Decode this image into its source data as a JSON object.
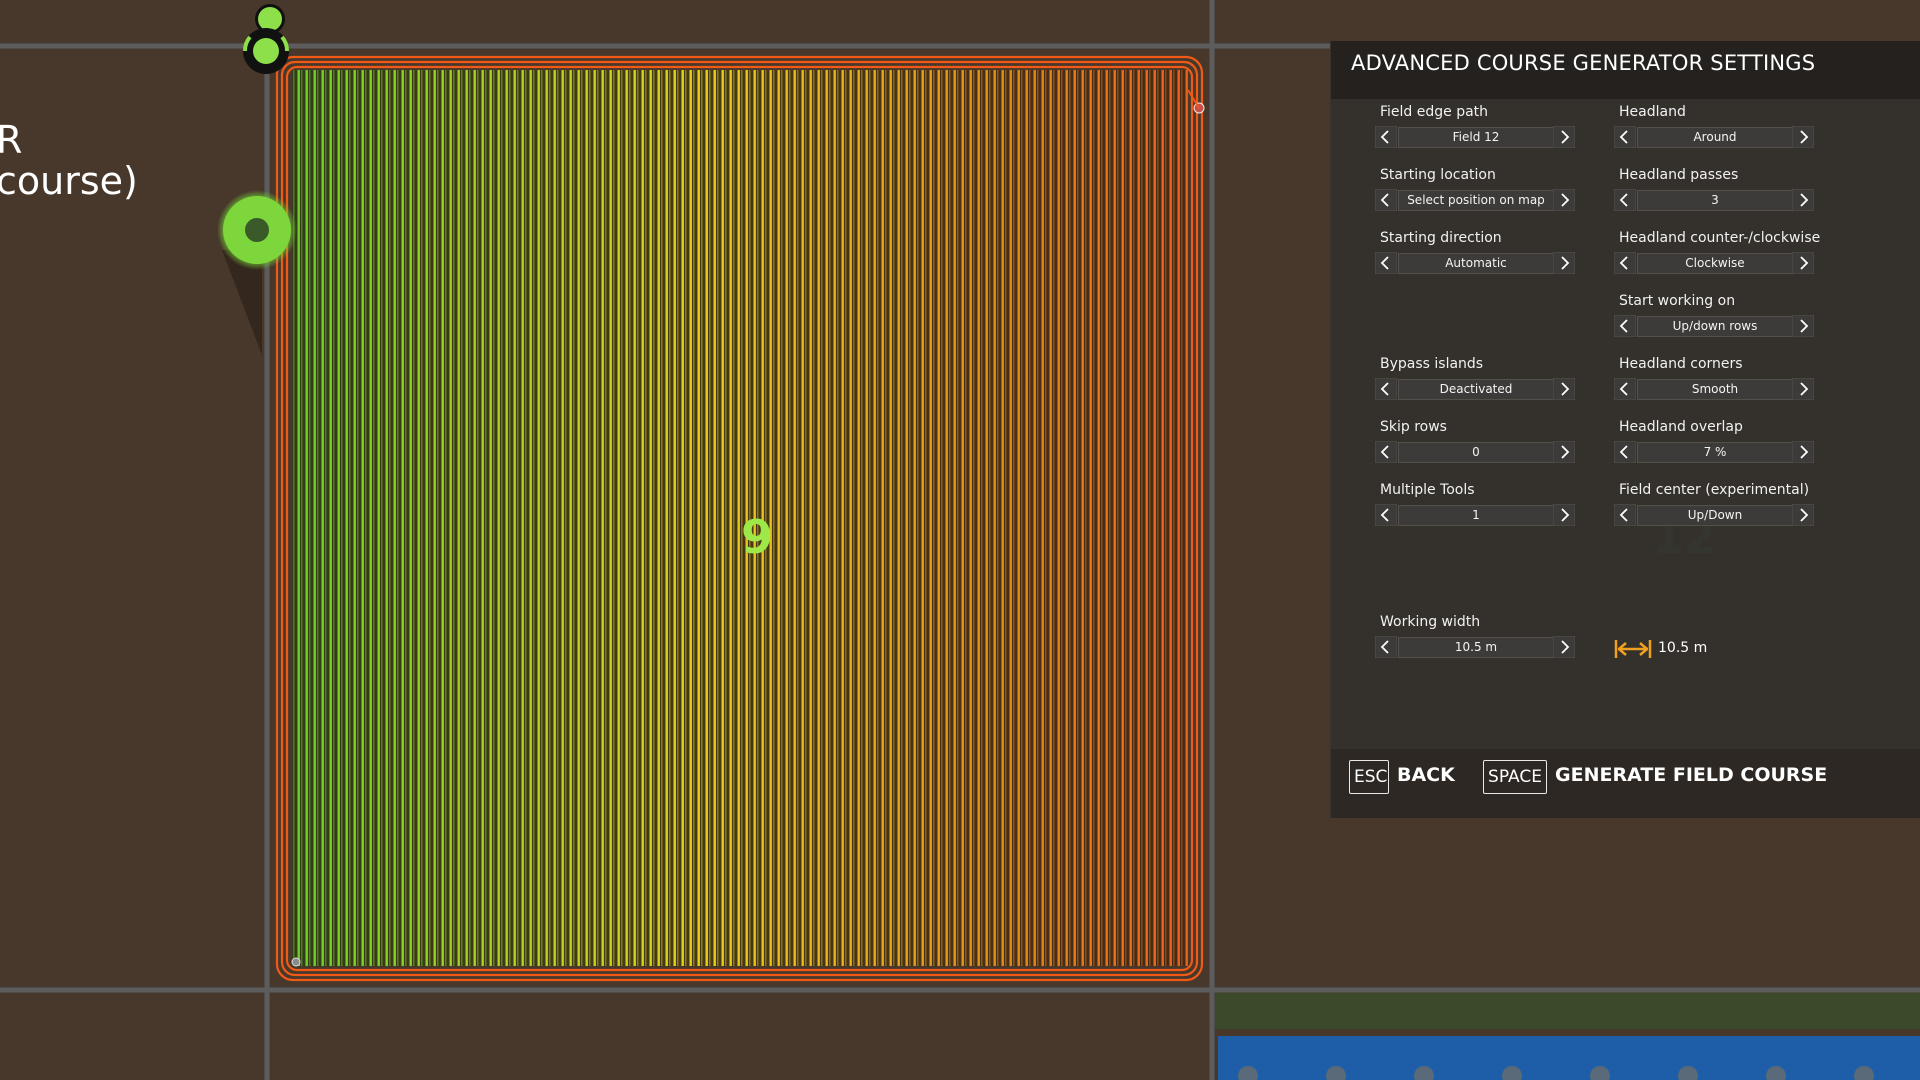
{
  "map": {
    "left_label_line1": "R",
    "left_label_line2": "course)",
    "field_number_main": "9",
    "field_number_secondary": "12"
  },
  "panel": {
    "title": "ADVANCED COURSE GENERATOR SETTINGS",
    "settings": {
      "field_edge_path": {
        "label": "Field edge path",
        "value": "Field 12"
      },
      "starting_location": {
        "label": "Starting location",
        "value": "Select position on map"
      },
      "starting_direction": {
        "label": "Starting direction",
        "value": "Automatic"
      },
      "bypass_islands": {
        "label": "Bypass islands",
        "value": "Deactivated"
      },
      "skip_rows": {
        "label": "Skip rows",
        "value": "0"
      },
      "multiple_tools": {
        "label": "Multiple Tools",
        "value": "1"
      },
      "working_width": {
        "label": "Working width",
        "value": "10.5 m"
      },
      "headland": {
        "label": "Headland",
        "value": "Around"
      },
      "headland_passes": {
        "label": "Headland passes",
        "value": "3"
      },
      "headland_direction": {
        "label": "Headland counter-/clockwise",
        "value": "Clockwise"
      },
      "start_working_on": {
        "label": "Start working on",
        "value": "Up/down rows"
      },
      "headland_corners": {
        "label": "Headland corners",
        "value": "Smooth"
      },
      "headland_overlap": {
        "label": "Headland overlap",
        "value": "7 %"
      },
      "field_center": {
        "label": "Field center (experimental)",
        "value": "Up/Down"
      }
    },
    "width_display": {
      "icon": "width-arrows-icon",
      "value": "10.5 m"
    },
    "footer": {
      "back_key": "ESC",
      "back_label": "BACK",
      "generate_key": "SPACE",
      "generate_label": "GENERATE FIELD COURSE"
    }
  },
  "colors": {
    "soil": "#4a3a2c",
    "road": "#5a5a5a",
    "row_start": "#6ad12a",
    "row_mid": "#e8d21a",
    "row_end": "#e8621a",
    "headland": "#ef5a16",
    "marker": "#8ee04a",
    "accent_orange": "#f0a020",
    "water": "#1e5ea8"
  }
}
